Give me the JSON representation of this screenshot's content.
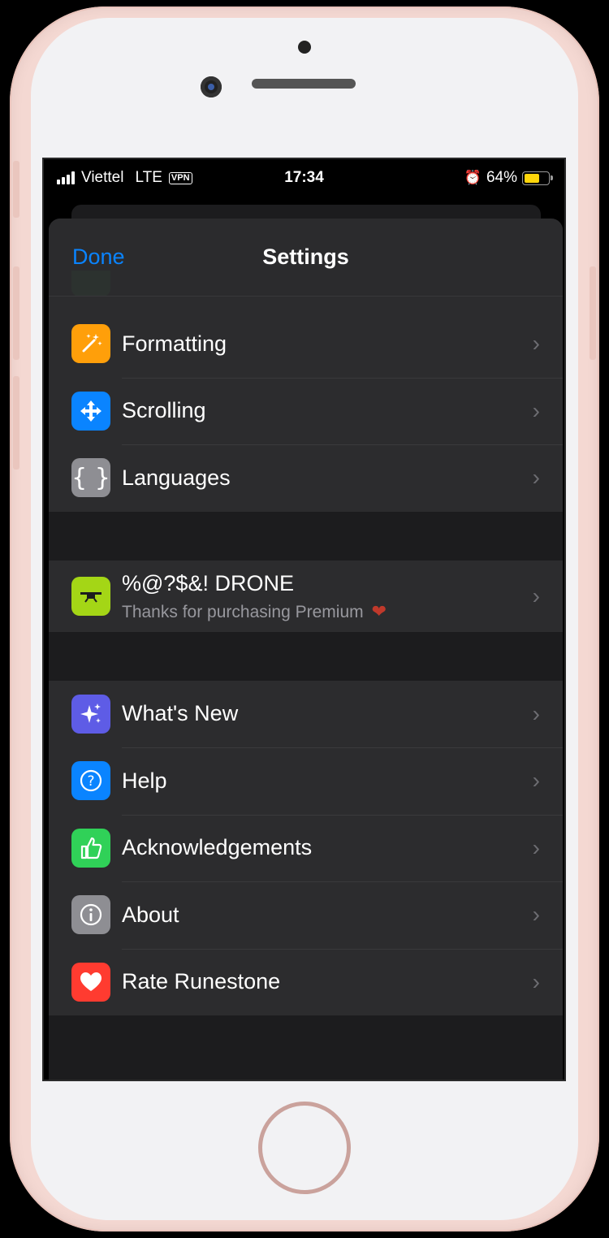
{
  "status_bar": {
    "carrier": "Viettel",
    "network": "LTE",
    "vpn": "VPN",
    "time": "17:34",
    "battery_percent": "64%",
    "battery_level": 0.64,
    "battery_color": "#ffd60a"
  },
  "nav": {
    "done_label": "Done",
    "title": "Settings"
  },
  "groups": {
    "editor": {
      "rows": [
        {
          "label": "Formatting",
          "icon": "magic-wand-icon",
          "color": "#ff9f0a"
        },
        {
          "label": "Scrolling",
          "icon": "move-arrows-icon",
          "color": "#0a84ff"
        },
        {
          "label": "Languages",
          "icon": "curly-braces-icon",
          "color": "#8e8e93"
        }
      ]
    },
    "premium": {
      "title": "%@?$&! DRONE",
      "subtitle": "Thanks for purchasing Premium",
      "icon": "drone-icon",
      "color": "#a4d616"
    },
    "info": {
      "rows": [
        {
          "label": "What's New",
          "icon": "sparkles-icon",
          "color": "#5e5ce6"
        },
        {
          "label": "Help",
          "icon": "question-icon",
          "color": "#0a84ff"
        },
        {
          "label": "Acknowledgements",
          "icon": "thumbs-up-icon",
          "color": "#30d158"
        },
        {
          "label": "About",
          "icon": "info-icon",
          "color": "#8e8e93"
        },
        {
          "label": "Rate Runestone",
          "icon": "heart-icon",
          "color": "#ff3b30"
        }
      ]
    }
  }
}
